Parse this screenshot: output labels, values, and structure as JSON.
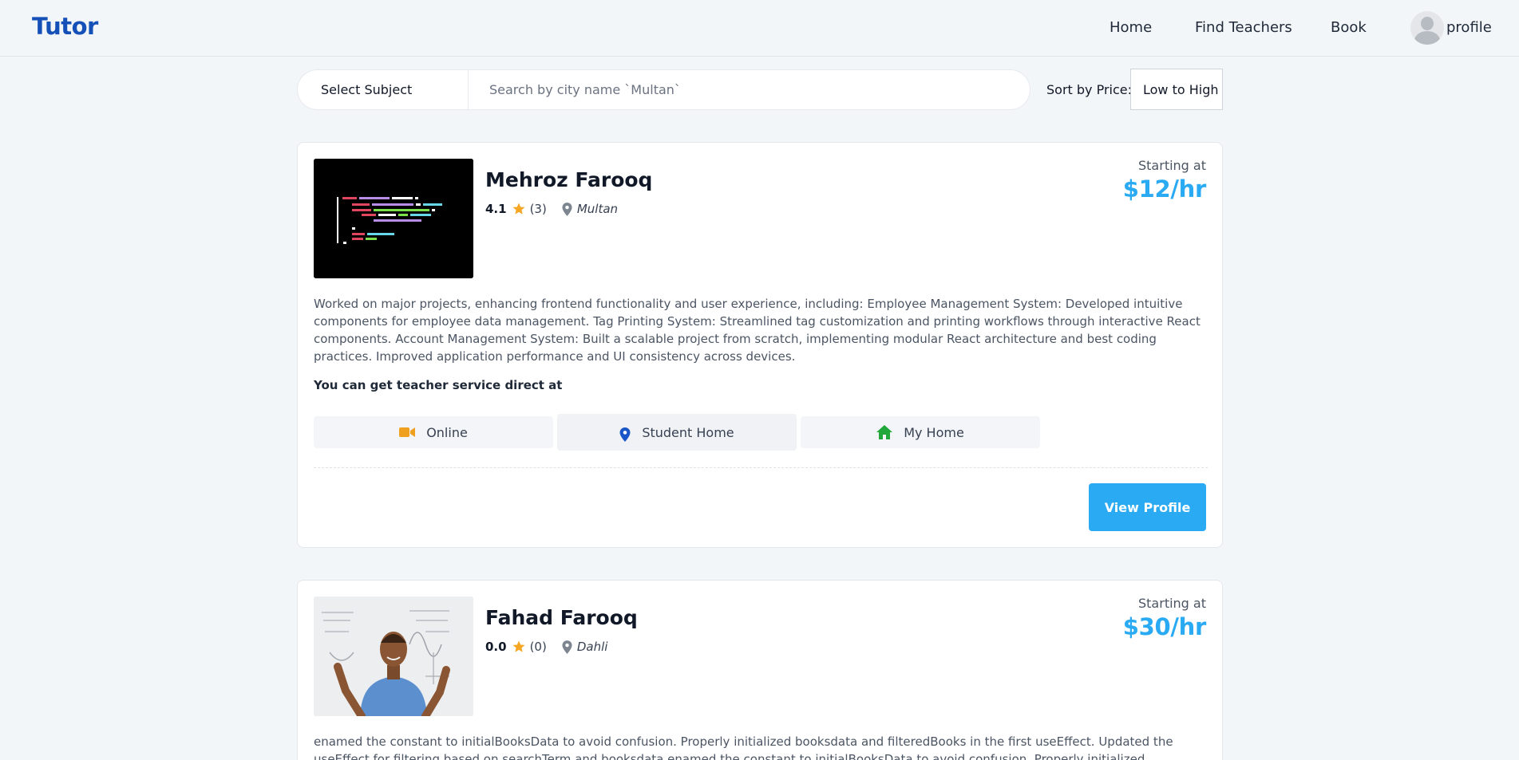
{
  "brand": "Tutor",
  "nav": {
    "home": "Home",
    "find_teachers": "Find Teachers",
    "book": "Book",
    "profile": "profile"
  },
  "search": {
    "subject_label": "Select Subject",
    "city_placeholder": "Search by city name `Multan`",
    "sort_label": "Sort by Price:",
    "sort_value": "Low to High"
  },
  "service_intro": "You can get teacher service direct at",
  "tutors": [
    {
      "name": "Mehroz Farooq",
      "rating": "4.1",
      "reviews": "(3)",
      "city": "Multan",
      "price_caption": "Starting at",
      "price": "$12/hr",
      "bio": "Worked on major projects, enhancing frontend functionality and user experience, including: Employee Management System: Developed intuitive components for employee data management. Tag Printing System: Streamlined tag customization and printing workflows through interactive React components. Account Management System: Built a scalable project from scratch, implementing modular React architecture and best coding practices. Improved application performance and UI consistency across devices.",
      "modes": [
        "Online",
        "Student Home",
        "My Home"
      ],
      "cta": "View Profile"
    },
    {
      "name": "Fahad Farooq",
      "rating": "0.0",
      "reviews": "(0)",
      "city": "Dahli",
      "price_caption": "Starting at",
      "price": "$30/hr",
      "bio": "enamed the constant to initialBooksData to avoid confusion. Properly initialized booksdata and filteredBooks in the first useEffect. Updated the useEffect for filtering based on searchTerm and booksdata enamed the constant to initialBooksData to avoid confusion. Properly initialized booksdata and"
    }
  ],
  "colors": {
    "brand": "#1550b8",
    "accent": "#2aaaf2",
    "star": "#f5a623",
    "video_icon": "#f0a020",
    "student_pin": "#1a56c8",
    "home_icon": "#22a83a"
  },
  "icons": {
    "rating": "star-icon",
    "location": "map-pin-icon",
    "online": "video-camera-icon",
    "student_home": "location-pin-icon",
    "my_home": "house-icon"
  }
}
